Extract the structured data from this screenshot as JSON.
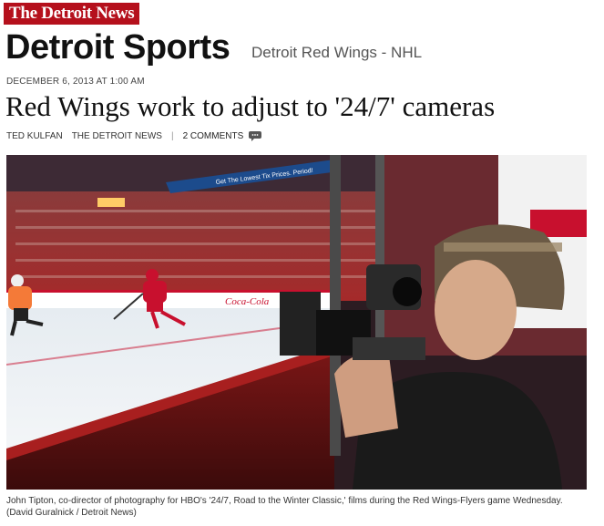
{
  "site": {
    "masthead": "The Detroit News"
  },
  "section": {
    "title": "Detroit Sports",
    "subtitle": "Detroit Red Wings - NHL"
  },
  "article": {
    "dateline": "DECEMBER 6, 2013 AT 1:00 AM",
    "headline": "Red Wings work to adjust to '24/7' cameras",
    "author": "TED KULFAN",
    "outlet": "THE DETROIT NEWS",
    "comments_label": "2 COMMENTS",
    "photo": {
      "banner_text": "Get The Lowest Tix Prices. Period!",
      "rink_sign": "Coca-Cola"
    },
    "caption": "John Tipton, co-director of photography for HBO's '24/7, Road to the Winter Classic,' films during the Red Wings-Flyers game Wednesday. (David Guralnick / Detroit News)"
  },
  "icons": {
    "comments": "speech-bubble-icon"
  },
  "colors": {
    "brand": "#b5101c",
    "wings_red": "#c8102e",
    "flyers_orange": "#f47a38"
  }
}
